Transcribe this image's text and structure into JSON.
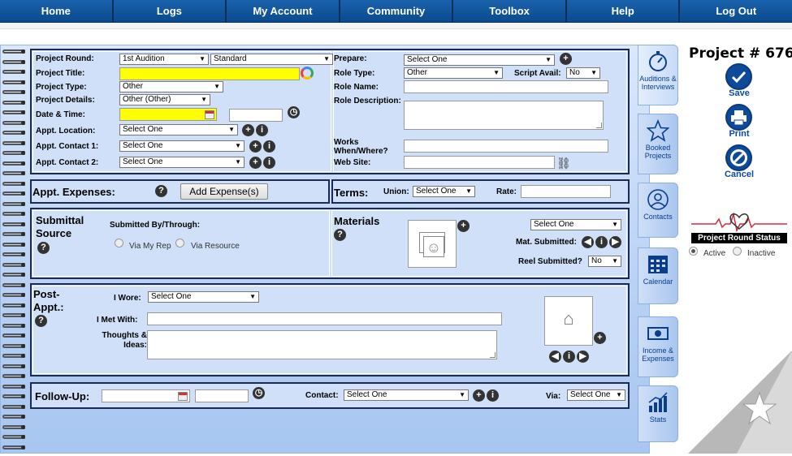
{
  "nav": [
    "Home",
    "Logs",
    "My Account",
    "Community",
    "Toolbox",
    "Help",
    "Log Out"
  ],
  "project": {
    "round_label": "Project Round:",
    "round_value": "1st Audition",
    "round_type": "Standard",
    "title_label": "Project Title:",
    "type_label": "Project Type:",
    "type_value": "Other",
    "details_label": "Project Details:",
    "details_value": "Other (Other)",
    "datetime_label": "Date & Time:",
    "location_label": "Appt. Location:",
    "location_value": "Select One",
    "contact1_label": "Appt. Contact 1:",
    "contact1_value": "Select One",
    "contact2_label": "Appt. Contact 2:",
    "contact2_value": "Select One"
  },
  "role": {
    "prepare_label": "Prepare:",
    "prepare_value": "Select One",
    "role_type_label": "Role Type:",
    "role_type_value": "Other",
    "script_avail_label": "Script Avail:",
    "script_avail_value": "No",
    "role_name_label": "Role Name:",
    "role_desc_label": "Role Description:",
    "works_label": "Works When/Where?",
    "website_label": "Web Site:"
  },
  "expenses": {
    "title": "Appt. Expenses:",
    "button": "Add Expense(s)"
  },
  "terms": {
    "title": "Terms:",
    "union_label": "Union:",
    "union_value": "Select One",
    "rate_label": "Rate:"
  },
  "submittal": {
    "title": "Submittal Source",
    "submitted_by": "Submitted By/Through:",
    "opt1": "Via My Rep",
    "opt2": "Via Resource"
  },
  "materials": {
    "title": "Materials",
    "select_value": "Select One",
    "mat_submitted": "Mat. Submitted:",
    "reel_label": "Reel Submitted?",
    "reel_value": "No"
  },
  "post": {
    "title": "Post-Appt.:",
    "wore_label": "I Wore:",
    "wore_value": "Select One",
    "met_label": "I Met With:",
    "thoughts_label": "Thoughts & Ideas:"
  },
  "followup": {
    "title": "Follow-Up:",
    "contact_label": "Contact:",
    "contact_value": "Select One",
    "via_label": "Via:",
    "via_value": "Select One"
  },
  "tabs": [
    "Auditions & Interviews",
    "Booked Projects",
    "Contacts",
    "Calendar",
    "Income & Expenses",
    "Stats"
  ],
  "right": {
    "project_no": "Project # 676",
    "save": "Save",
    "print": "Print",
    "cancel": "Cancel",
    "status_title": "Project Round Status",
    "active": "Active",
    "inactive": "Inactive"
  },
  "colors": {
    "nav": "#0a4a8f",
    "yellow": "#ffff00",
    "accent": "#0d4a9b"
  }
}
